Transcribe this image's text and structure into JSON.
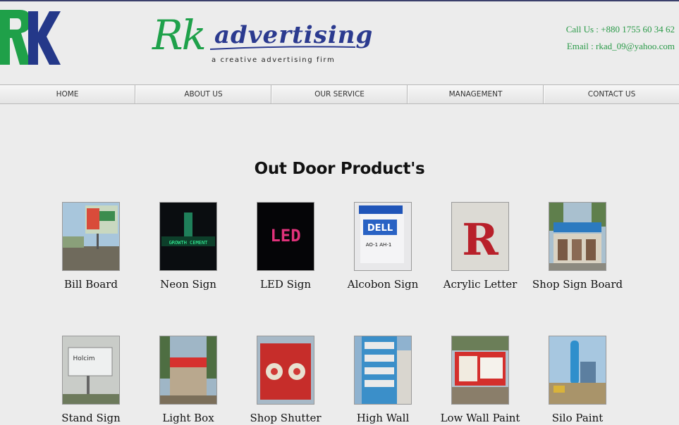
{
  "header": {
    "logo_text": "RK",
    "brand_rk": "Rk",
    "brand_name": "advertising",
    "tagline": "a creative advertising firm",
    "call_us": "Call Us : +880 1755 60 34 62",
    "email": "Email : rkad_09@yahoo.com"
  },
  "nav": {
    "items": [
      "HOME",
      "ABOUT US",
      "OUR SERVICE",
      "MANAGEMENT",
      "CONTACT US"
    ]
  },
  "section": {
    "title": "Out Door Product's"
  },
  "products": [
    {
      "label": "Bill Board",
      "icon": "billboard-photo"
    },
    {
      "label": "Neon Sign",
      "icon": "neon-sign-photo"
    },
    {
      "label": "LED Sign",
      "icon": "led-sign-photo"
    },
    {
      "label": "Alcobon Sign",
      "icon": "alcobon-sign-photo"
    },
    {
      "label": "Acrylic Letter",
      "icon": "acrylic-letter-photo"
    },
    {
      "label": "Shop Sign Board",
      "icon": "shop-sign-photo"
    },
    {
      "label": "Stand Sign",
      "icon": "stand-sign-photo"
    },
    {
      "label": "Light Box",
      "icon": "light-box-photo"
    },
    {
      "label": "Shop Shutter",
      "icon": "shop-shutter-photo"
    },
    {
      "label": "High Wall",
      "icon": "high-wall-photo"
    },
    {
      "label": "Low Wall Paint",
      "icon": "low-wall-photo"
    },
    {
      "label": "Silo Paint",
      "icon": "silo-paint-photo"
    }
  ],
  "colors": {
    "brand_green": "#1ea14a",
    "brand_blue": "#2b3a8f",
    "contact_green": "#2a9a48",
    "page_bg": "#ececec"
  }
}
